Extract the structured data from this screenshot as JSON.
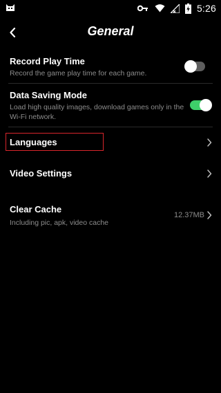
{
  "status_bar": {
    "time": "5:26",
    "icons": [
      "app-icon",
      "key-icon",
      "wifi-icon",
      "signal-icon",
      "battery-charging-icon"
    ]
  },
  "header": {
    "title": "General",
    "back_icon": "chevron-left-icon"
  },
  "settings": {
    "record_play_time": {
      "title": "Record Play Time",
      "description": "Record the game play time for each game.",
      "enabled": false
    },
    "data_saving_mode": {
      "title": "Data Saving Mode",
      "description": "Load high quality images, download games only in the Wi-Fi network.",
      "enabled": true
    },
    "languages": {
      "title": "Languages",
      "highlighted": true
    },
    "video_settings": {
      "title": "Video Settings"
    },
    "clear_cache": {
      "title": "Clear Cache",
      "description": "Including pic, apk, video cache",
      "size": "12.37MB"
    }
  },
  "colors": {
    "background": "#000000",
    "toggle_on": "#3ecf6a",
    "toggle_off": "#5e5e5e",
    "secondary_text": "#8c8c8c",
    "highlight_box": "#d9262c"
  }
}
